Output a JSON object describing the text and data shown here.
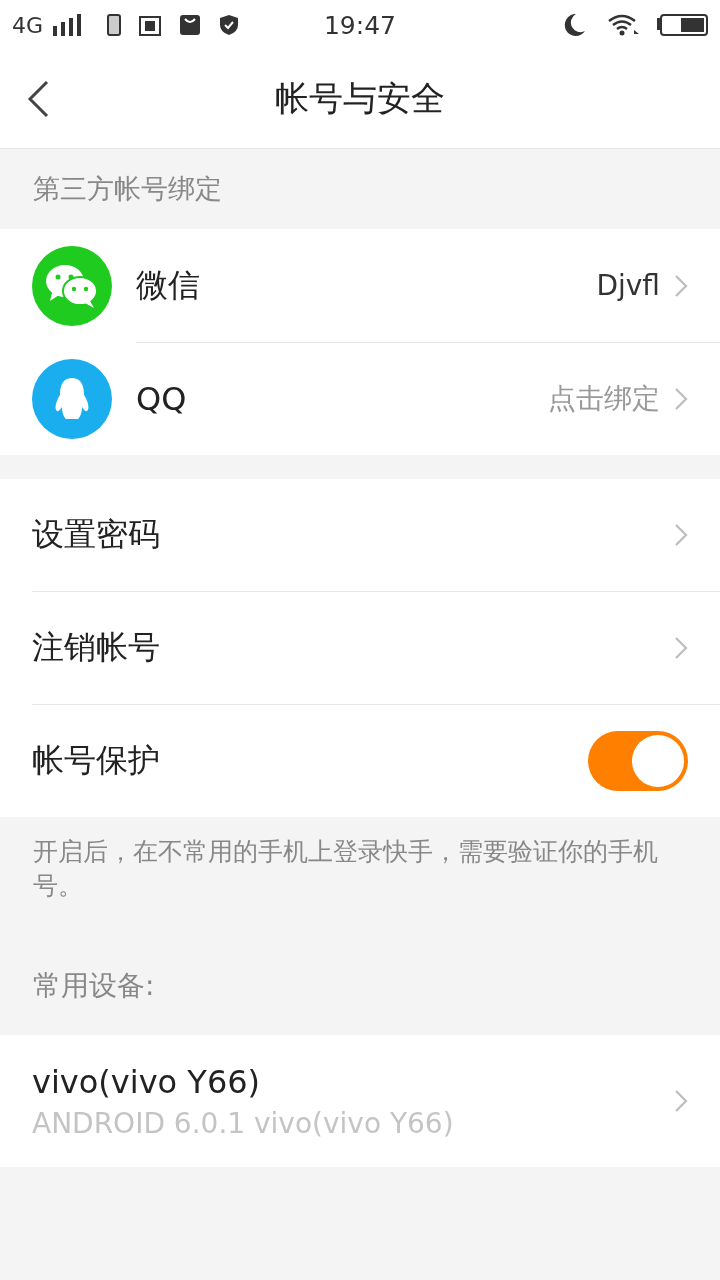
{
  "status_bar": {
    "network": "4G",
    "time": "19:47"
  },
  "header": {
    "title": "帐号与安全"
  },
  "third_party": {
    "heading": "第三方帐号绑定",
    "items": [
      {
        "kind": "wechat",
        "label": "微信",
        "value": "Djvfl",
        "value_muted": false
      },
      {
        "kind": "qq",
        "label": "QQ",
        "value": "点击绑定",
        "value_muted": true
      }
    ]
  },
  "settings": [
    {
      "kind": "link",
      "label": "设置密码"
    },
    {
      "kind": "link",
      "label": "注销帐号"
    },
    {
      "kind": "toggle",
      "label": "帐号保护",
      "on": true
    }
  ],
  "protection_note": "开启后，在不常用的手机上登录快手，需要验证你的手机号。",
  "devices": {
    "heading": "常用设备:",
    "items": [
      {
        "name": "vivo(vivo Y66)",
        "detail": "ANDROID  6.0.1 vivo(vivo Y66)"
      }
    ]
  }
}
